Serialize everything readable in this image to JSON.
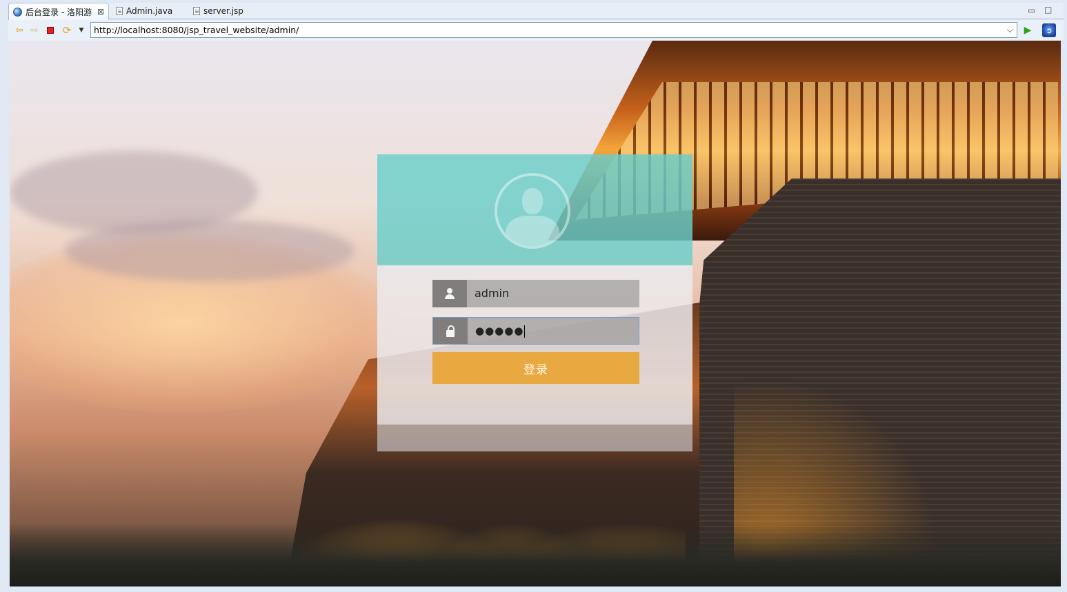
{
  "tabs": [
    {
      "label": "后台登录 - 洛阳游",
      "active": true,
      "icon": "globe-icon"
    },
    {
      "label": "Admin.java",
      "active": false,
      "icon": "java-file-icon"
    },
    {
      "label": "server.jsp",
      "active": false,
      "icon": "jsp-file-icon"
    }
  ],
  "window_controls": {
    "minimize": "▭",
    "maximize": "□"
  },
  "address_bar": {
    "url": "http://localhost:8080/jsp_travel_website/admin/"
  },
  "login": {
    "username_value": "admin",
    "password_mask": "●●●●●",
    "submit_label": "登录"
  },
  "colors": {
    "header_teal": "#6acecb",
    "button_orange": "#e8a535",
    "input_bg": "#a09d9d"
  }
}
